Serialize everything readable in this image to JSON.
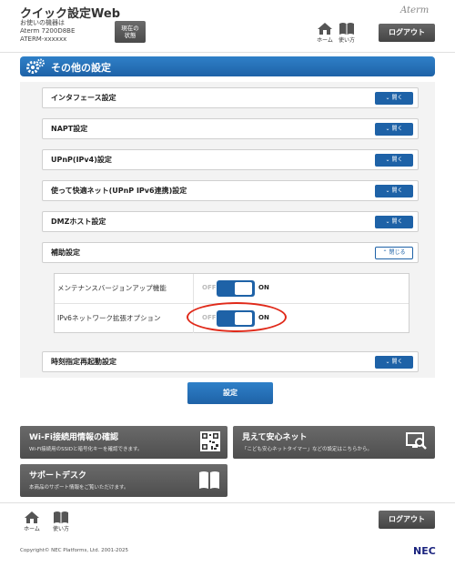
{
  "header": {
    "app_title": "クイック設定Web",
    "device_lines": [
      "お使いの機器は",
      "Aterm 7200D8BE",
      "ATERM-xxxxxx"
    ],
    "status_button": [
      "現在の",
      "状態"
    ],
    "brand": "Aterm",
    "home_label": "ホーム",
    "manual_label": "使い方",
    "logout_label": "ログアウト"
  },
  "section": {
    "title": "その他の設定"
  },
  "accordions": [
    {
      "label": "インタフェース設定",
      "button": "開く"
    },
    {
      "label": "NAPT設定",
      "button": "開く"
    },
    {
      "label": "UPnP(IPv4)設定",
      "button": "開く"
    },
    {
      "label": "使って快適ネット(UPnP IPv6連携)設定",
      "button": "開く"
    },
    {
      "label": "DMZホスト設定",
      "button": "開く"
    },
    {
      "label": "補助設定",
      "button": "閉じる"
    },
    {
      "label": "時刻指定再起動設定",
      "button": "開く"
    }
  ],
  "aux_settings": [
    {
      "name": "メンテナンスバージョンアップ機能",
      "off": "OFF",
      "on": "ON",
      "state": "ON"
    },
    {
      "name": "IPv6ネットワーク拡張オプション",
      "off": "OFF",
      "on": "ON",
      "state": "ON"
    }
  ],
  "submit_label": "設定",
  "cards": [
    {
      "title": "Wi-Fi接続用情報の確認",
      "desc": "Wi-Fi接続用のSSIDと暗号化キーを確認できます。",
      "icon": "qr-code-icon"
    },
    {
      "title": "見えて安心ネット",
      "desc": "「こども安心ネットタイマー」などの設定はこちらから。",
      "icon": "monitor-search-icon"
    },
    {
      "title": "サポートデスク",
      "desc": "本商品のサポート情報をご覧いただけます。",
      "icon": "book-icon"
    }
  ],
  "footer": {
    "home_label": "ホーム",
    "manual_label": "使い方",
    "logout_label": "ログアウト",
    "copyright": "Copyright© NEC Platforms, Ltd. 2001-2025",
    "maker": "NEC"
  },
  "colors": {
    "accent": "#1e62a7",
    "dark_button": "#4e4e4e",
    "highlight": "#e02a1a"
  }
}
